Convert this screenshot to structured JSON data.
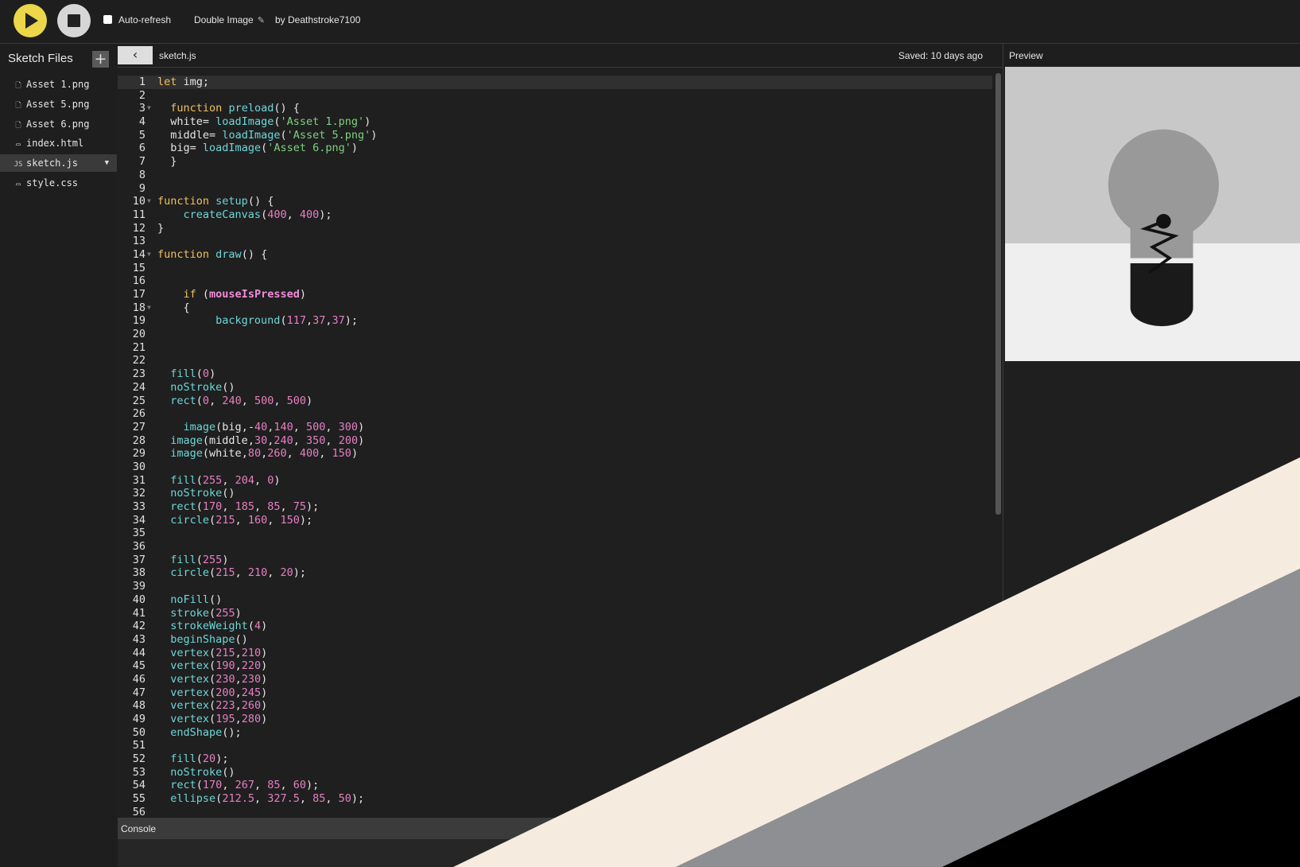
{
  "toolbar": {
    "autorefresh_label": "Auto-refresh",
    "project_title": "Double Image",
    "byline": "by Deathstroke7100",
    "icons": {
      "play": "play-icon",
      "stop": "stop-icon",
      "edit": "pencil-icon"
    },
    "colors": {
      "play": "#ecd64a",
      "stop": "#d6d6d6"
    }
  },
  "sidebar": {
    "title": "Sketch Files",
    "add_label": "+",
    "files": [
      {
        "name": "Asset 1.png",
        "icon": "file-icon"
      },
      {
        "name": "Asset 5.png",
        "icon": "file-icon"
      },
      {
        "name": "Asset 6.png",
        "icon": "file-icon"
      },
      {
        "name": "index.html",
        "icon": "html-icon"
      },
      {
        "name": "sketch.js",
        "icon": "js-icon",
        "active": true
      },
      {
        "name": "style.css",
        "icon": "css-icon"
      }
    ],
    "js_badge": "JS",
    "caret": "▼"
  },
  "editor": {
    "collapse_glyph": "‹",
    "tab_filename": "sketch.js",
    "saved_status": "Saved: 10 days ago",
    "lines": [
      "let img;",
      "",
      "  function preload() {",
      "  white= loadImage('Asset 1.png')",
      "  middle= loadImage('Asset 5.png')",
      "  big= loadImage('Asset 6.png')",
      "  }",
      "",
      "",
      "function setup() {",
      "    createCanvas(400, 400);",
      "}",
      "",
      "function draw() {",
      "",
      "",
      "    if (mouseIsPressed)",
      "    {",
      "         background(117,37,37);",
      "",
      "",
      "",
      "  fill(0)",
      "  noStroke()",
      "  rect(0, 240, 500, 500)",
      "",
      "    image(big,-40,140, 500, 300)",
      "  image(middle,30,240, 350, 200)",
      "  image(white,80,260, 400, 150)",
      "",
      "  fill(255, 204, 0)",
      "  noStroke()",
      "  rect(170, 185, 85, 75);",
      "  circle(215, 160, 150);",
      "",
      "",
      "  fill(255)",
      "  circle(215, 210, 20);",
      "",
      "  noFill()",
      "  stroke(255)",
      "  strokeWeight(4)",
      "  beginShape()",
      "  vertex(215,210)",
      "  vertex(190,220)",
      "  vertex(230,230)",
      "  vertex(200,245)",
      "  vertex(223,260)",
      "  vertex(195,280)",
      "  endShape();",
      "",
      "  fill(20);",
      "  noStroke()",
      "  rect(170, 267, 85, 60);",
      "  ellipse(212.5, 327.5, 85, 50);",
      ""
    ],
    "fold_lines": [
      3,
      10,
      14,
      18
    ],
    "current_line": 1
  },
  "console": {
    "label": "Console"
  },
  "preview": {
    "label": "Preview",
    "colors": {
      "top_bg": "#c8c8c8",
      "bottom_bg": "#efefef",
      "bulb": "#999999",
      "base": "#1a1a1a",
      "filament": "#111111"
    }
  },
  "overlay_colors": [
    "#f6ebdf",
    "#8e8f92",
    "#000000"
  ]
}
